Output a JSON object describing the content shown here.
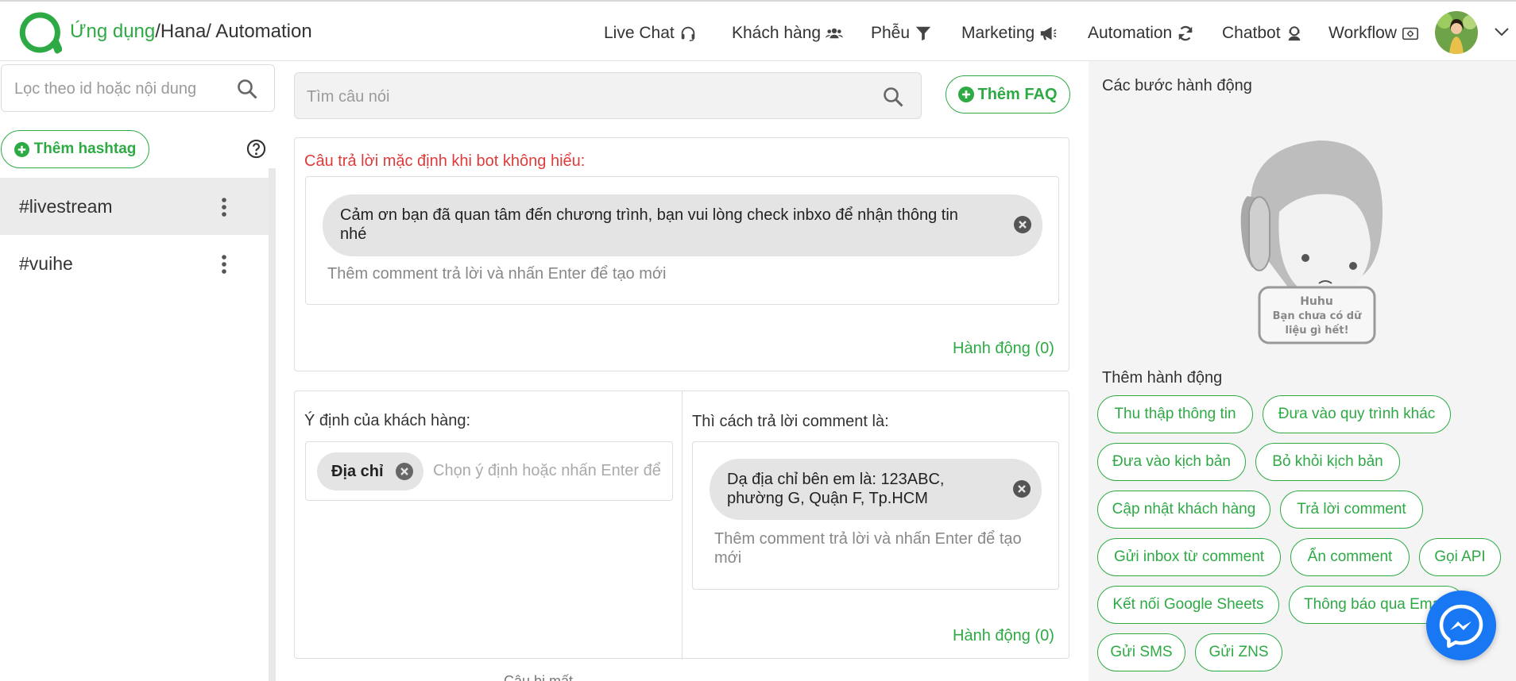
{
  "header": {
    "breadcrumb_app": "Ứng dụng",
    "breadcrumb_rest": "/Hana/ Automation",
    "nav": [
      {
        "label": "Live Chat",
        "icon": "headset-icon"
      },
      {
        "label": "Khách hàng",
        "icon": "users-icon"
      },
      {
        "label": "Phễu",
        "icon": "funnel-icon"
      },
      {
        "label": "Marketing",
        "icon": "megaphone-icon"
      },
      {
        "label": "Automation",
        "icon": "sync-icon"
      },
      {
        "label": "Chatbot",
        "icon": "bot-icon"
      },
      {
        "label": "Workflow",
        "icon": "workflow-icon"
      }
    ]
  },
  "sidebar": {
    "filter_placeholder": "Lọc theo id hoặc nội dung",
    "add_hashtag_label": "Thêm hashtag",
    "tags": [
      {
        "label": "#livestream",
        "active": true
      },
      {
        "label": "#vuihe",
        "active": false
      }
    ]
  },
  "main": {
    "search_placeholder": "Tìm câu nói",
    "add_faq_label": "Thêm FAQ",
    "default_reply": {
      "title": "Câu trả lời mặc định khi bot không hiểu:",
      "reply_text": "Cảm ơn bạn đã quan tâm đến chương trình, bạn vui lòng check inbxo để nhận thông tin nhé",
      "input_hint": "Thêm comment trả lời và nhấn Enter để tạo mới",
      "action_label": "Hành động (0)"
    },
    "intent_block": {
      "intent_label": "Ý định của khách hàng:",
      "intent_chip": "Địa chỉ",
      "intent_placeholder": "Chọn ý định hoặc nhấn Enter để tạo mới",
      "reply_label": "Thì cách trả lời comment là:",
      "reply_text": "Dạ địa chỉ bên em là: 123ABC, phường G, Quận F, Tp.HCM",
      "input_hint": "Thêm comment trả lời và nhấn Enter để tạo mới",
      "action_label": "Hành động (0)"
    },
    "bottom_cut_text": "Câu bị mất"
  },
  "right_panel": {
    "steps_title": "Các bước hành động",
    "empty_title": "Huhu",
    "empty_message": "Bạn chưa có dữ liệu gì hết!",
    "add_action_title": "Thêm hành động",
    "actions": [
      "Thu thập thông tin",
      "Đưa vào quy trình khác",
      "Đưa vào kịch bản",
      "Bỏ khỏi kịch bản",
      "Cập nhật khách hàng",
      "Trả lời comment",
      "Gửi inbox từ comment",
      "Ẩn comment",
      "Gọi API",
      "Kết nối Google Sheets",
      "Thông báo qua Email",
      "Gửi SMS",
      "Gửi ZNS"
    ]
  },
  "colors": {
    "accent_green": "#2eaa45",
    "error_red": "#e03b3b",
    "messenger_blue": "#1877f2"
  }
}
